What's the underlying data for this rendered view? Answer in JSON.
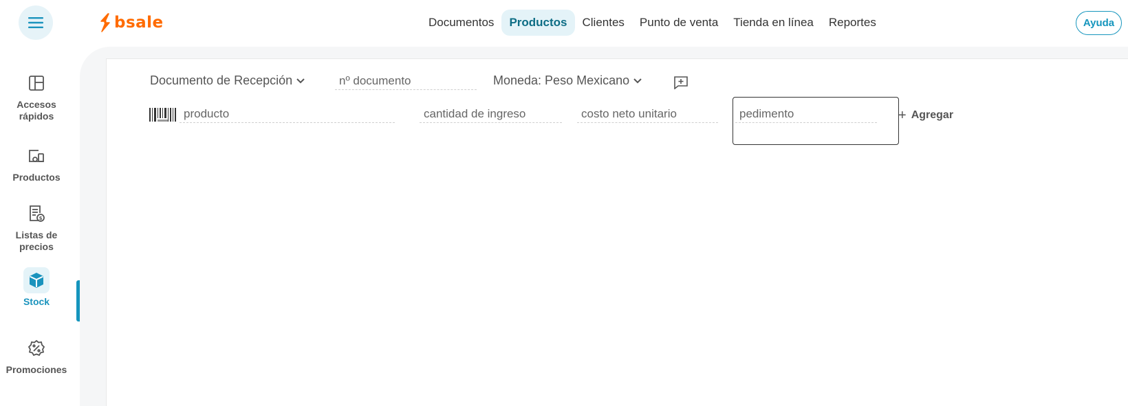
{
  "header": {
    "logo_text": "bsale",
    "nav": [
      {
        "label": "Documentos",
        "active": false
      },
      {
        "label": "Productos",
        "active": true
      },
      {
        "label": "Clientes",
        "active": false
      },
      {
        "label": "Punto de venta",
        "active": false
      },
      {
        "label": "Tienda en línea",
        "active": false
      },
      {
        "label": "Reportes",
        "active": false
      }
    ],
    "help_label": "Ayuda"
  },
  "sidebar": {
    "items": [
      {
        "label": "Accesos rápidos",
        "icon": "layout-icon",
        "active": false
      },
      {
        "label": "Productos",
        "icon": "products-icon",
        "active": false
      },
      {
        "label": "Listas de precios",
        "icon": "price-list-icon",
        "active": false
      },
      {
        "label": "Stock",
        "icon": "box-icon",
        "active": true
      },
      {
        "label": "Promociones",
        "icon": "discount-badge-icon",
        "active": false
      }
    ]
  },
  "form": {
    "document_type": "Documento de Recepción",
    "document_number_placeholder": "nº documento",
    "currency": "Moneda: Peso Mexicano",
    "product_placeholder": "producto",
    "quantity_placeholder": "cantidad de ingreso",
    "unit_cost_placeholder": "costo neto unitario",
    "pedimento_placeholder": "pedimento",
    "add_label": "Agregar"
  },
  "colors": {
    "brand_orange": "#ff6b00",
    "accent_blue": "#1595bd",
    "active_bg": "#e4f3f8"
  }
}
